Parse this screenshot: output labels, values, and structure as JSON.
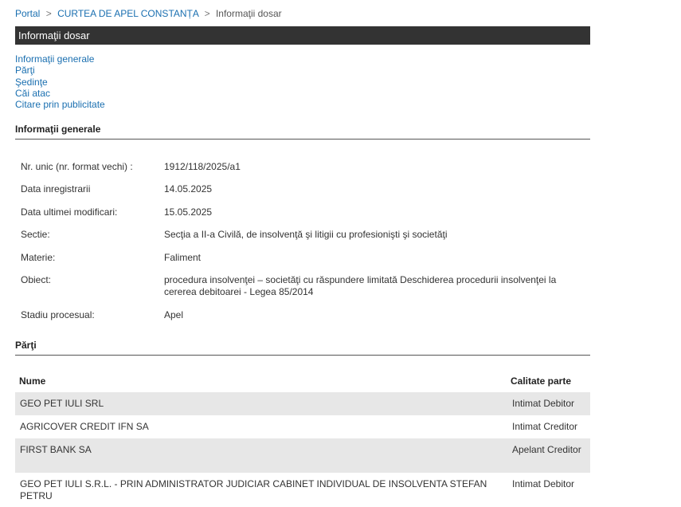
{
  "breadcrumb": {
    "portal": "Portal",
    "separator": ">",
    "court": "CURTEA DE APEL CONSTANȚA",
    "current": "Informaţii dosar"
  },
  "page_title": "Informaţii dosar",
  "nav": {
    "items": [
      "Informaţii generale",
      "Părţi",
      "Şedinţe",
      "Căi atac",
      "Citare prin publicitate"
    ]
  },
  "general": {
    "heading": "Informaţii generale",
    "rows": [
      {
        "label": "Nr. unic (nr. format vechi) :",
        "value": "1912/118/2025/a1"
      },
      {
        "label": "Data inregistrarii",
        "value": "14.05.2025"
      },
      {
        "label": "Data ultimei modificari:",
        "value": "15.05.2025"
      },
      {
        "label": "Sectie:",
        "value": "Secţia a II-a Civilă, de insolvenţă şi litigii cu profesionişti şi societăţi"
      },
      {
        "label": "Materie:",
        "value": "Faliment"
      },
      {
        "label": "Obiect:",
        "value": "procedura insolvenţei – societăţi cu răspundere limitată Deschiderea procedurii insolvenţei la cererea debitoarei - Legea 85/2014"
      },
      {
        "label": "Stadiu procesual:",
        "value": "Apel"
      }
    ]
  },
  "parties": {
    "heading": "Părţi",
    "columns": {
      "name": "Nume",
      "role": "Calitate parte"
    },
    "rows": [
      {
        "name": "GEO PET IULI SRL",
        "role": "Intimat Debitor"
      },
      {
        "name": "AGRICOVER CREDIT IFN SA",
        "role": "Intimat Creditor"
      },
      {
        "name": "FIRST BANK SA",
        "role": "Apelant Creditor"
      },
      {
        "name": "GEO PET IULI S.R.L. - PRIN ADMINISTRATOR JUDICIAR CABINET INDIVIDUAL DE INSOLVENTA STEFAN PETRU",
        "role": "Intimat Debitor"
      }
    ]
  },
  "colors": {
    "title_bar": "#333333",
    "link": "#1a6fb0",
    "row_shade": "#e7e7e7"
  }
}
